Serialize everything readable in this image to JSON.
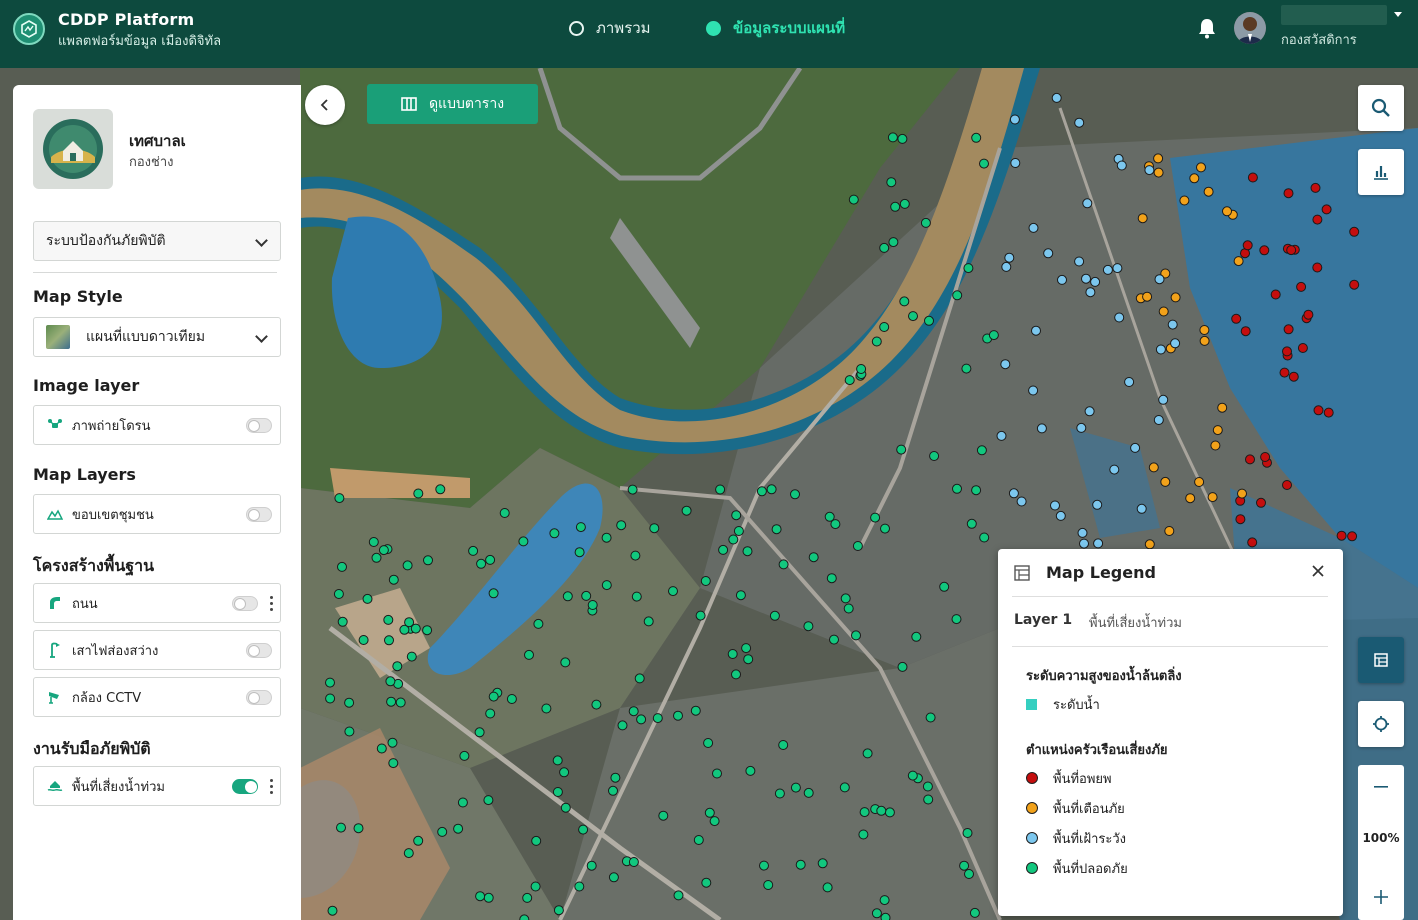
{
  "header": {
    "brand_title": "CDDP Platform",
    "brand_subtitle": "แพลตฟอร์มข้อมูล เมืองดิจิทัล",
    "nav": [
      {
        "label": "ภาพรวม",
        "active": false
      },
      {
        "label": "ข้อมูลระบบแผนที่",
        "active": true
      }
    ],
    "user_department": "กองสวัสดิการ"
  },
  "sidebar": {
    "org_name": "เทศบาลเ",
    "org_department": "กองช่าง",
    "system_select": "ระบบป้องกันภัยพิบัติ",
    "map_style": {
      "title": "Map Style",
      "selected": "แผนที่แบบดาวเทียม"
    },
    "image_layer": {
      "title": "Image layer",
      "items": [
        {
          "label": "ภาพถ่ายโดรน",
          "on": false
        }
      ]
    },
    "map_layers": {
      "title": "Map Layers",
      "items": [
        {
          "label": "ขอบเขตชุมชน",
          "on": false
        }
      ]
    },
    "infrastructure": {
      "title": "โครงสร้างพื้นฐาน",
      "items": [
        {
          "label": "ถนน",
          "on": false
        },
        {
          "label": "เสาไฟส่องสว่าง",
          "on": false
        },
        {
          "label": "กล้อง CCTV",
          "on": false
        }
      ]
    },
    "disaster": {
      "title": "งานรับมือภัยพิบัติ",
      "items": [
        {
          "label": "พื้นที่เสี่ยงน้ำท่วม",
          "on": true
        }
      ]
    }
  },
  "map": {
    "table_view_button": "ดูแบบตาราง",
    "zoom_level": "100%"
  },
  "legend": {
    "title": "Map Legend",
    "layer_label": "Layer 1",
    "layer_name": "พื้นที่เสี่ยงน้ำท่วม",
    "water_heading": "ระดับความสูงของน้ำล้นตลิ่ง",
    "water_item": {
      "label": "ระดับน้ำ",
      "color": "#35cfc0"
    },
    "risk_heading": "ตำแหน่งครัวเรือนเสี่ยงภัย",
    "risk_items": [
      {
        "label": "พื้นที่อพยพ",
        "color": "#c40e0e"
      },
      {
        "label": "พื้นที่เตือนภัย",
        "color": "#f2a21a"
      },
      {
        "label": "พื้นที่เฝ้าระวัง",
        "color": "#7cc7ee"
      },
      {
        "label": "พื้นที่ปลอดภัย",
        "color": "#12c77e"
      }
    ]
  },
  "colors": {
    "header_bg": "#0d4a3e",
    "accent": "#1a9f78",
    "active_nav": "#2fe2b1"
  },
  "icons": [
    "app-logo-icon",
    "bell-icon",
    "collapse-left-icon",
    "table-columns-icon",
    "search-icon",
    "chart-icon",
    "legend-icon",
    "locate-icon",
    "zoom-out-icon",
    "zoom-in-icon",
    "close-icon",
    "chevron-down-icon",
    "drone-icon",
    "boundary-icon",
    "road-icon",
    "streetlight-icon",
    "cctv-icon",
    "flood-icon"
  ]
}
